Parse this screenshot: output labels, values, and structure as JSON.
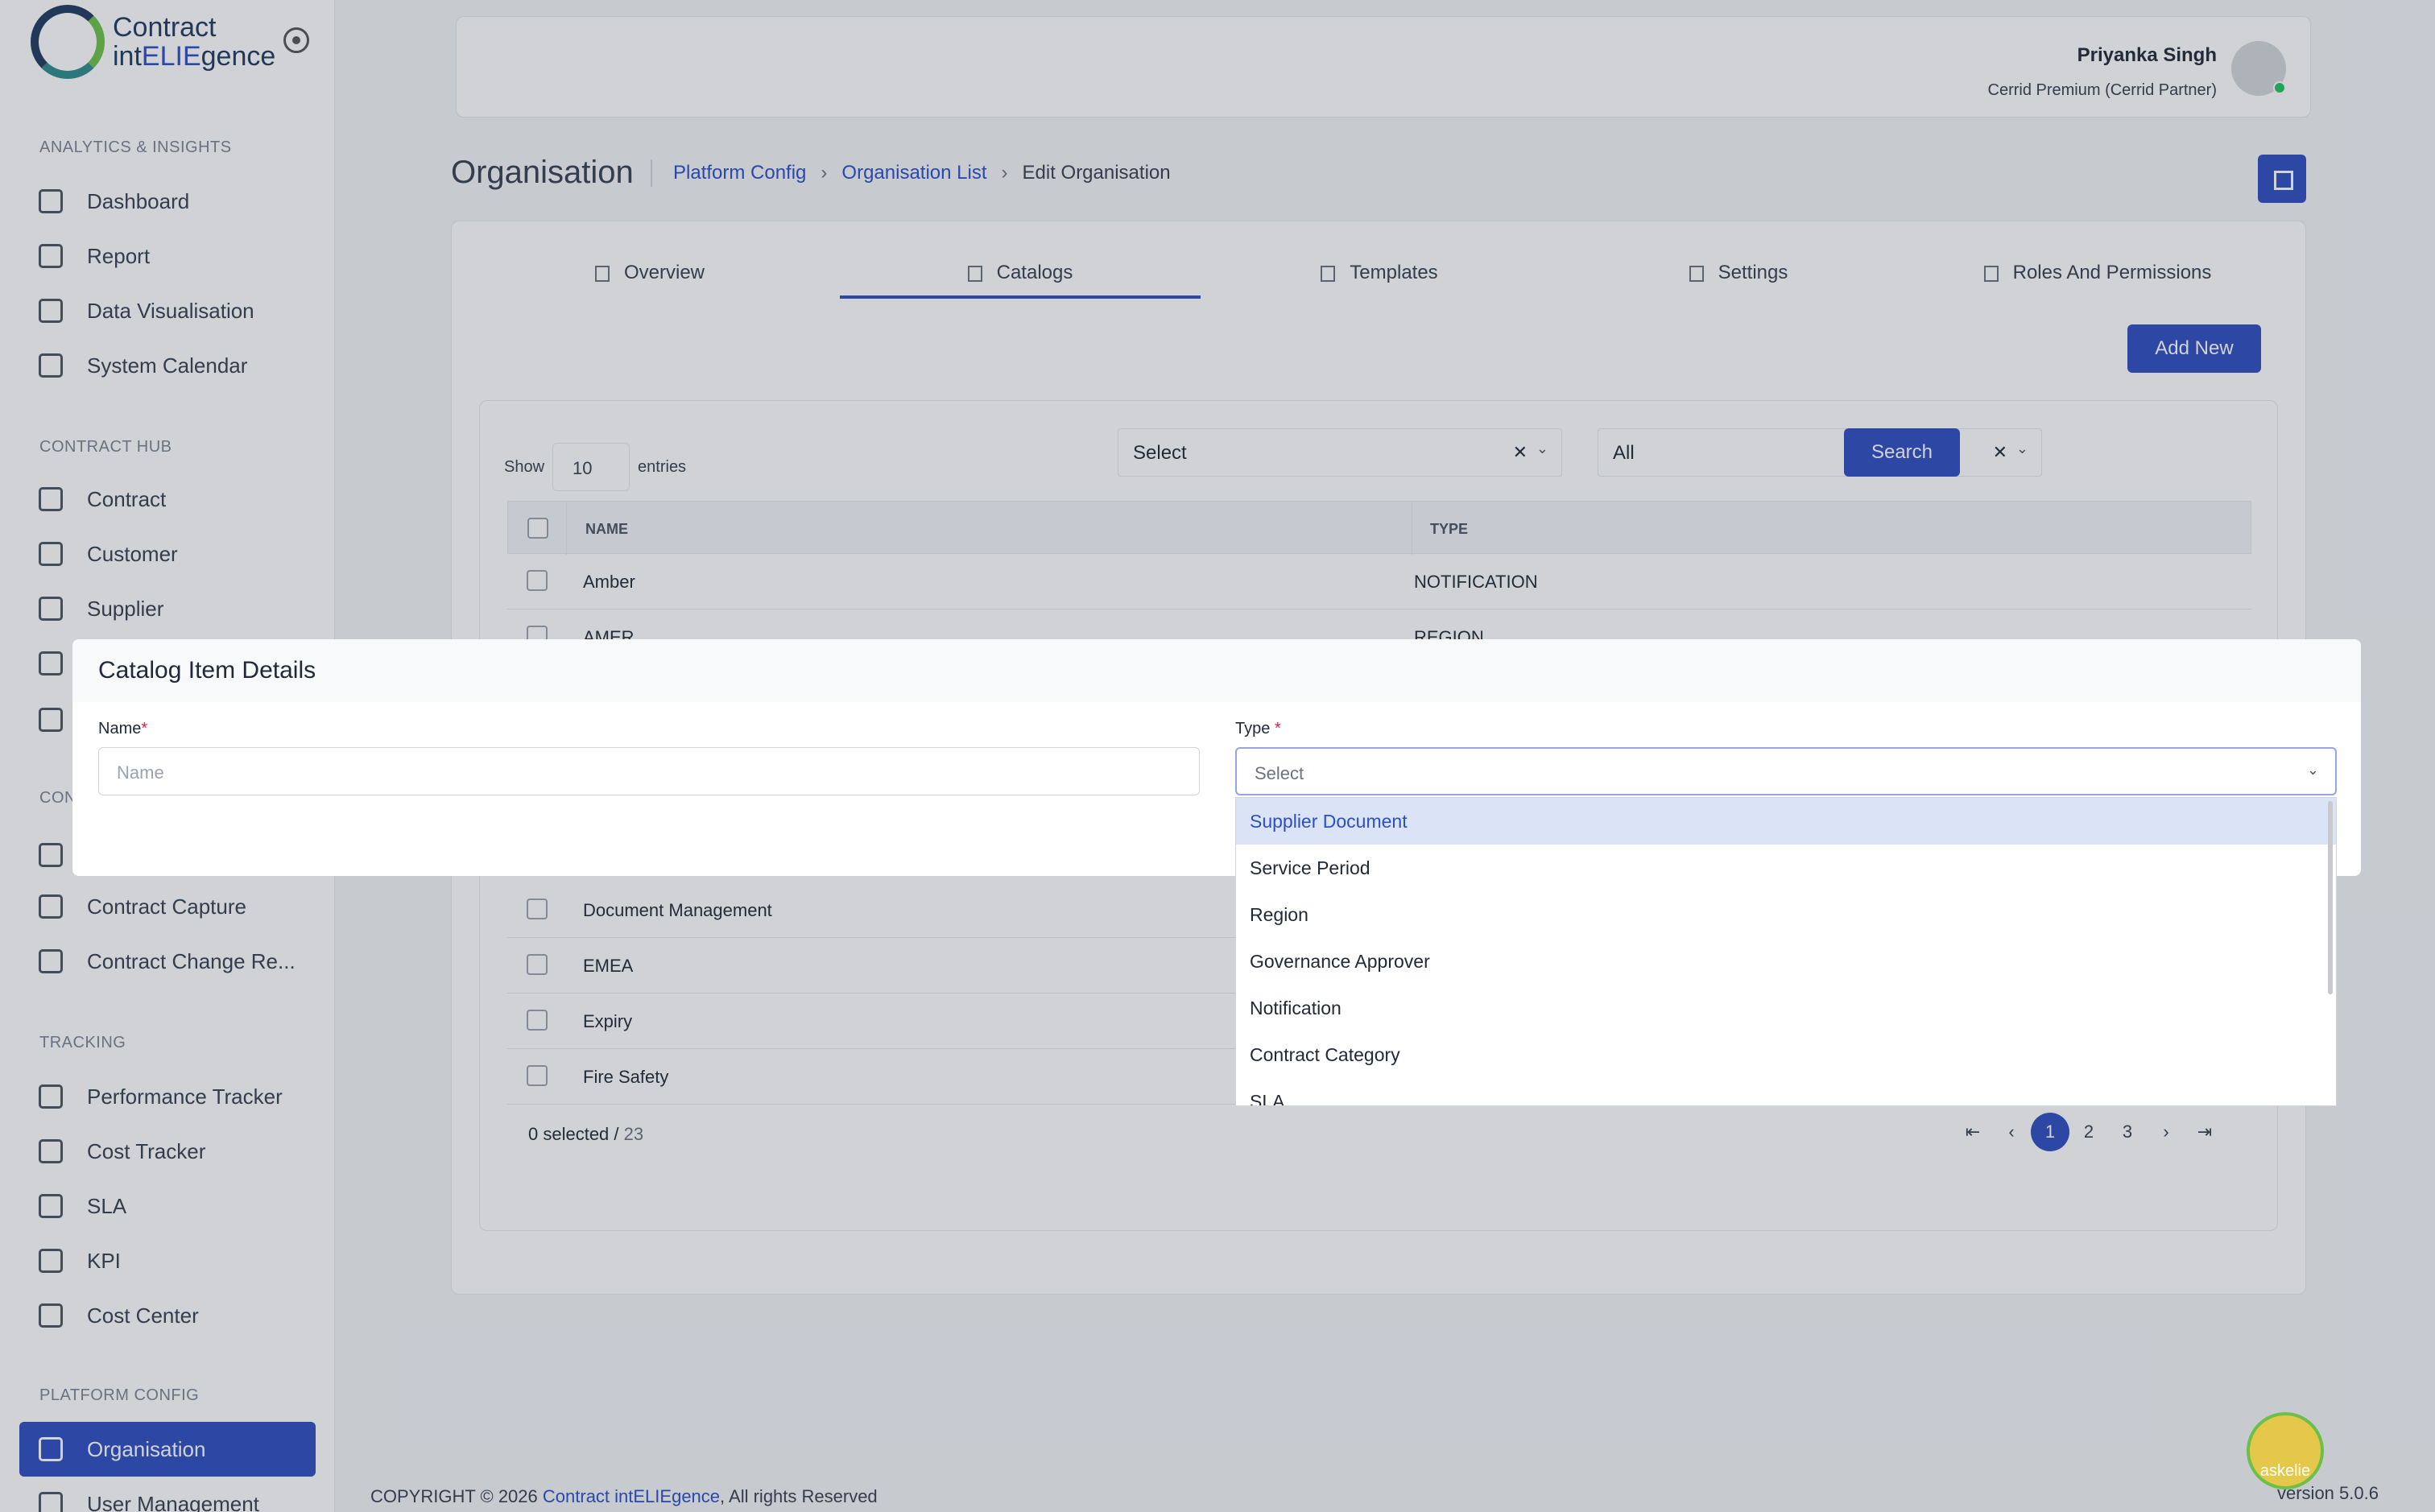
{
  "brand": {
    "line1": "Contract",
    "line2_a": "int",
    "line2_b": "ELIE",
    "line2_c": "gence"
  },
  "sidebar": {
    "sections": [
      {
        "title": "ANALYTICS & INSIGHTS"
      },
      {
        "title": "CONTRACT HUB"
      },
      {
        "title": "CON"
      },
      {
        "title": "TRACKING"
      },
      {
        "title": "PLATFORM CONFIG"
      }
    ],
    "items": [
      {
        "label": "Dashboard",
        "icon": "home-icon"
      },
      {
        "label": "Report",
        "icon": "mail-icon"
      },
      {
        "label": "Data Visualisation",
        "icon": "bar-chart-icon"
      },
      {
        "label": "System Calendar",
        "icon": "calendar-icon"
      },
      {
        "label": "Contract",
        "icon": "file-icon"
      },
      {
        "label": "Customer",
        "icon": "user-icon"
      },
      {
        "label": "Supplier",
        "icon": "truck-icon"
      },
      {
        "label": "",
        "icon": "book-icon"
      },
      {
        "label": "",
        "icon": "grid-icon"
      },
      {
        "label": "",
        "icon": "file-icon"
      },
      {
        "label": "Contract Capture",
        "icon": "file-icon"
      },
      {
        "label": "Contract Change Re...",
        "icon": "file-icon"
      },
      {
        "label": "Performance Tracker",
        "icon": "activity-icon"
      },
      {
        "label": "Cost Tracker",
        "icon": "trending-down-icon"
      },
      {
        "label": "SLA",
        "icon": "pen-tool-icon"
      },
      {
        "label": "KPI",
        "icon": "sliders-icon"
      },
      {
        "label": "Cost Center",
        "icon": "paperclip-icon"
      },
      {
        "label": "Organisation",
        "icon": "calendar-icon"
      },
      {
        "label": "User Management",
        "icon": "users-icon"
      }
    ]
  },
  "header": {
    "user_name": "Priyanka Singh",
    "user_role": "Cerrid Premium (Cerrid Partner)"
  },
  "page": {
    "title": "Organisation",
    "breadcrumb": [
      "Platform Config",
      "Organisation List",
      "Edit Organisation"
    ],
    "tabs": [
      "Overview",
      "Catalogs",
      "Templates",
      "Settings",
      "Roles And Permissions"
    ],
    "add_new": "Add New"
  },
  "table_controls": {
    "show": "Show",
    "entries_value": "10",
    "entries": "entries",
    "filter1": "Select",
    "filter2": "All",
    "search": "Search"
  },
  "table": {
    "headers": [
      "NAME",
      "TYPE"
    ],
    "rows": [
      {
        "name": "Amber",
        "type": "NOTIFICATION"
      },
      {
        "name": "AMER",
        "type": "REGION"
      },
      {
        "name": "Document Management",
        "type": ""
      },
      {
        "name": "EMEA",
        "type": ""
      },
      {
        "name": "Expiry",
        "type": ""
      },
      {
        "name": "Fire Safety",
        "type": ""
      }
    ],
    "selected": "0 selected / ",
    "total": "23",
    "pages": [
      "1",
      "2",
      "3"
    ]
  },
  "modal": {
    "title": "Catalog Item Details",
    "name_label": "Name",
    "name_placeholder": "Name",
    "type_label": "Type ",
    "type_placeholder": "Select",
    "options": [
      "Supplier Document",
      "Service Period",
      "Region",
      "Governance Approver",
      "Notification",
      "Contract Category",
      "SLA"
    ]
  },
  "footer": {
    "copyright": "COPYRIGHT © 2026 ",
    "brand": "Contract intELIEgence",
    "rights": ", All rights Reserved",
    "version": "version 5.0.6"
  },
  "askelie": "askelie",
  "colors": {
    "accent": "#2f4fbf",
    "link": "#2b4fc7",
    "highlight": "#dbe4f7"
  }
}
